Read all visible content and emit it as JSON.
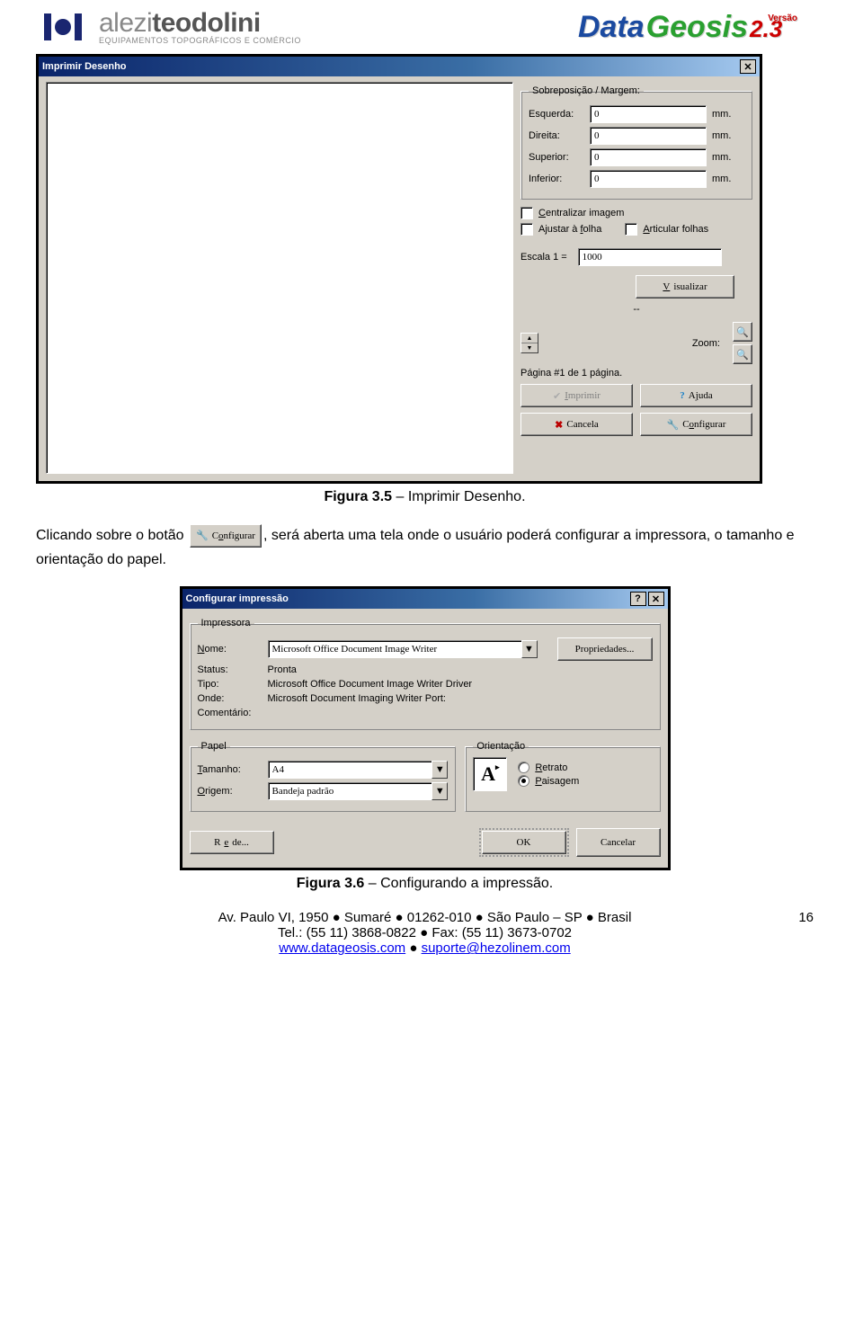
{
  "header": {
    "brand_a": "alezi",
    "brand_b": "teodolini",
    "brand_sub": "EQUIPAMENTOS TOPOGRÁFICOS E COMÉRCIO",
    "product_a": "Data",
    "product_b": "Geosis",
    "version": "2.3",
    "version_word": "Versão"
  },
  "dialog1": {
    "title": "Imprimir Desenho",
    "group_margin": "Sobreposição / Margem:",
    "left_label": "Esquerda:",
    "right_label": "Direita:",
    "top_label": "Superior:",
    "bottom_label": "Inferior:",
    "left_val": "0",
    "right_val": "0",
    "top_val": "0",
    "bottom_val": "0",
    "unit": "mm.",
    "chk_center": "Centralizar imagem",
    "chk_fit": "Ajustar à folha",
    "chk_articulate": "Articular folhas",
    "scale_label": "Escala  1 =",
    "scale_val": "1000",
    "btn_preview": "Visualizar",
    "status_dash": "--",
    "zoom_label": "Zoom:",
    "page_status": "Página #1 de 1 página.",
    "btn_print": "Imprimir",
    "btn_help": "Ajuda",
    "btn_cancel": "Cancela",
    "btn_config": "Configurar"
  },
  "caption1_a": "Figura 3.5",
  "caption1_b": " – Imprimir Desenho.",
  "body": {
    "pre": "Clicando sobre o botão ",
    "inline_btn": "Configurar",
    "post": ", será aberta uma tela onde o usuário poderá configurar a impressora, o tamanho e orientação do papel."
  },
  "dialog2": {
    "title": "Configurar impressão",
    "grp_printer": "Impressora",
    "name_label": "Nome:",
    "name_val": "Microsoft Office Document Image Writer",
    "props_btn": "Propriedades...",
    "status_label": "Status:",
    "status_val": "Pronta",
    "type_label": "Tipo:",
    "type_val": "Microsoft Office Document Image Writer Driver",
    "where_label": "Onde:",
    "where_val": "Microsoft Document Imaging Writer Port:",
    "comment_label": "Comentário:",
    "grp_paper": "Papel",
    "size_label": "Tamanho:",
    "size_val": "A4",
    "source_label": "Origem:",
    "source_val": "Bandeja padrão",
    "grp_orient": "Orientação",
    "orient_portrait": "Retrato",
    "orient_landscape": "Paisagem",
    "orient_glyph": "A",
    "btn_network": "Rede...",
    "btn_ok": "OK",
    "btn_cancel": "Cancelar"
  },
  "caption2_a": "Figura 3.6",
  "caption2_b": " – Configurando a impressão.",
  "footer": {
    "line1": "Av. Paulo VI, 1950 ● Sumaré ● 01262-010 ● São Paulo – SP ● Brasil",
    "line2": "Tel.: (55 11) 3868-0822 ● Fax: (55 11) 3673-0702",
    "link1": "www.datageosis.com",
    "sep": " ● ",
    "link2": "suporte@hezolinem.com",
    "page": "16"
  }
}
